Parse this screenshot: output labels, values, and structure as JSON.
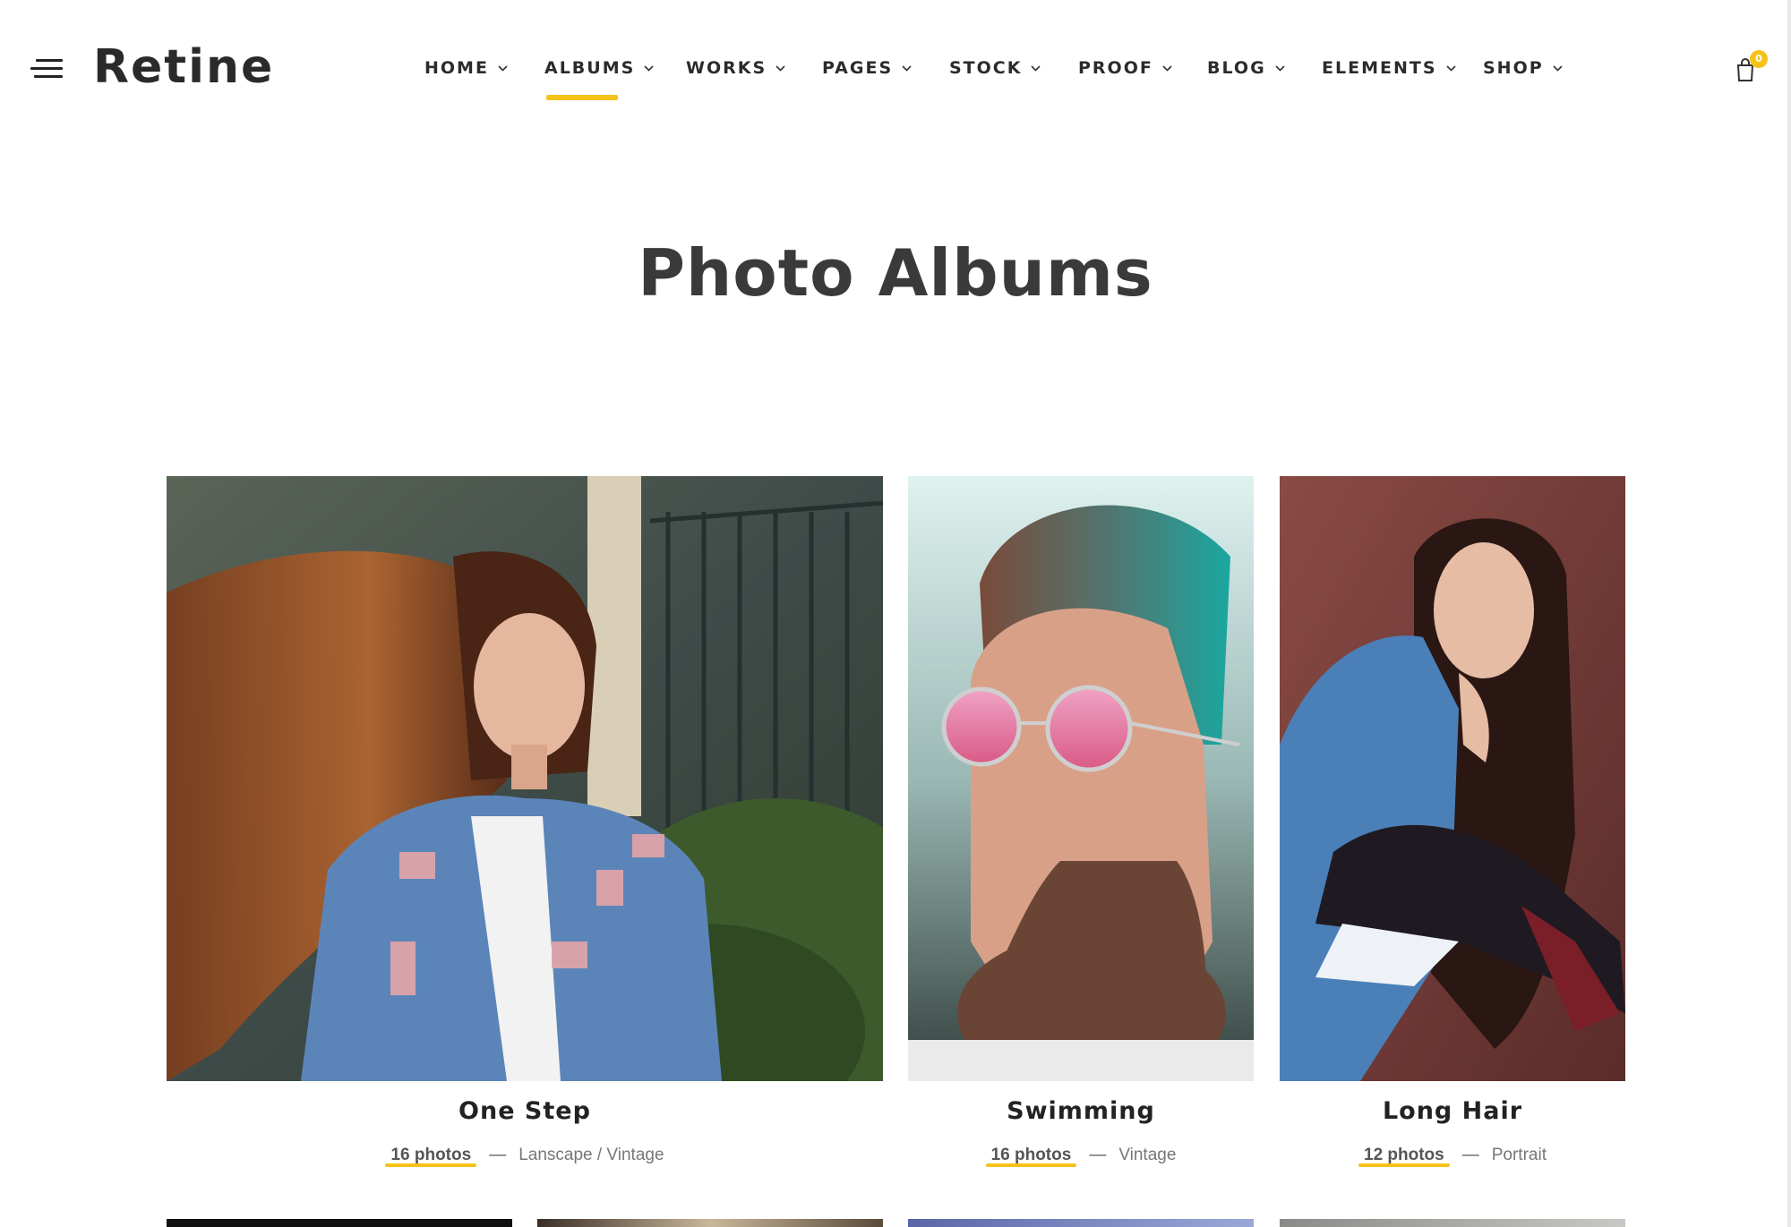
{
  "brand": {
    "logo": "Retine"
  },
  "nav": {
    "items": [
      {
        "label": "HOME"
      },
      {
        "label": "ALBUMS"
      },
      {
        "label": "WORKS"
      },
      {
        "label": "PAGES"
      },
      {
        "label": "STOCK"
      },
      {
        "label": "PROOF"
      },
      {
        "label": "BLOG"
      },
      {
        "label": "ELEMENTS"
      },
      {
        "label": "SHOP"
      }
    ],
    "active": "ALBUMS"
  },
  "cart": {
    "count": "0"
  },
  "page": {
    "title": "Photo Albums"
  },
  "albums": [
    {
      "title": "One Step",
      "count": "16 photos",
      "tags": "Lanscape / Vintage"
    },
    {
      "title": "Swimming",
      "count": "16 photos",
      "tags": "Vintage"
    },
    {
      "title": "Long Hair",
      "count": "12 photos",
      "tags": "Portrait"
    }
  ],
  "colors": {
    "accent": "#f5c21b",
    "text": "#2b2b2b"
  },
  "icons": {
    "menu": "hamburger-menu-icon",
    "cart": "shopping-bag-icon",
    "dropdown": "chevron-down-icon"
  }
}
